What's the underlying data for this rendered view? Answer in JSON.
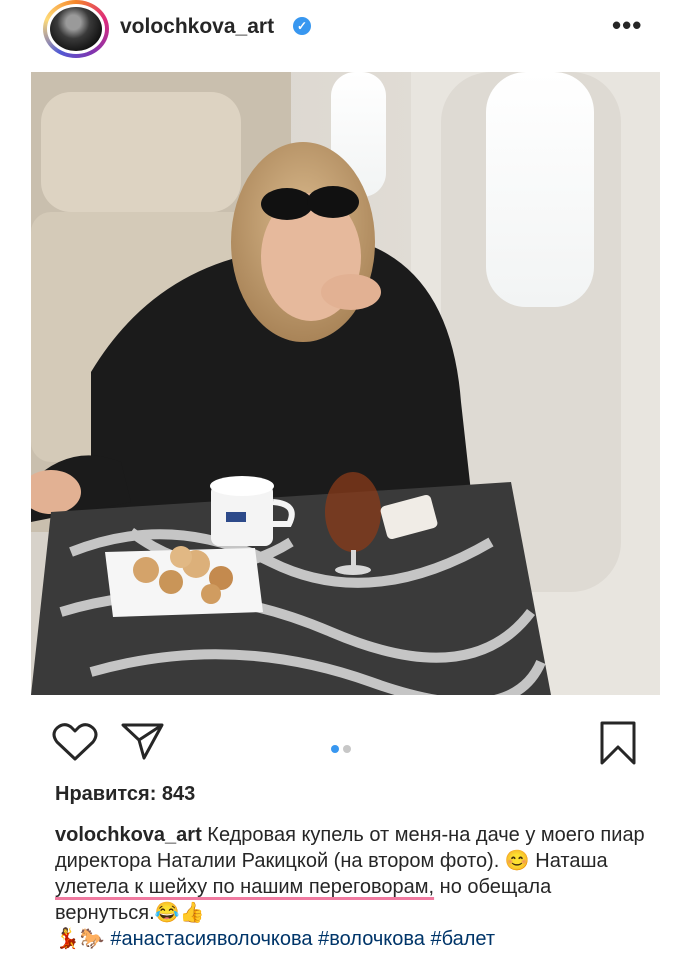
{
  "header": {
    "username": "volochkova_art",
    "verified_glyph": "✓",
    "more_glyph": "•••",
    "icons": [
      "avatar",
      "verified-badge-icon",
      "more-options-icon"
    ]
  },
  "post": {
    "image_alt": "woman in sunglasses seated at a marble table in an airplane cabin with a cup, a glass of brandy and a dish of cookies",
    "carousel": {
      "index": 1,
      "count": 2
    }
  },
  "actions": {
    "icons": [
      "heart-icon",
      "send-icon",
      "bookmark-icon"
    ]
  },
  "likes": {
    "text": "Нравится: 843"
  },
  "caption": {
    "username": "volochkova_art",
    "part1": " Кедровая купель от меня-на даче у моего пиар директора Наталии Ракицкой (на втором фото). ",
    "emoji1": "😊",
    "part2": " Наташа ",
    "highlight": "улетела к шейху по нашим переговорам,",
    "part3": " но обещала вернуться.",
    "emoji2": "😂👍",
    "emoji3": "💃🐎",
    "hashtags": " #анастасияволочкова #волочкова #балет"
  },
  "colors": {
    "text": "#262626",
    "verified": "#3897f0",
    "dot_active": "#3897f0",
    "dot_inactive": "#c7c7c7",
    "hashtag": "#003569",
    "highlight_underline": "#f07aa0"
  }
}
